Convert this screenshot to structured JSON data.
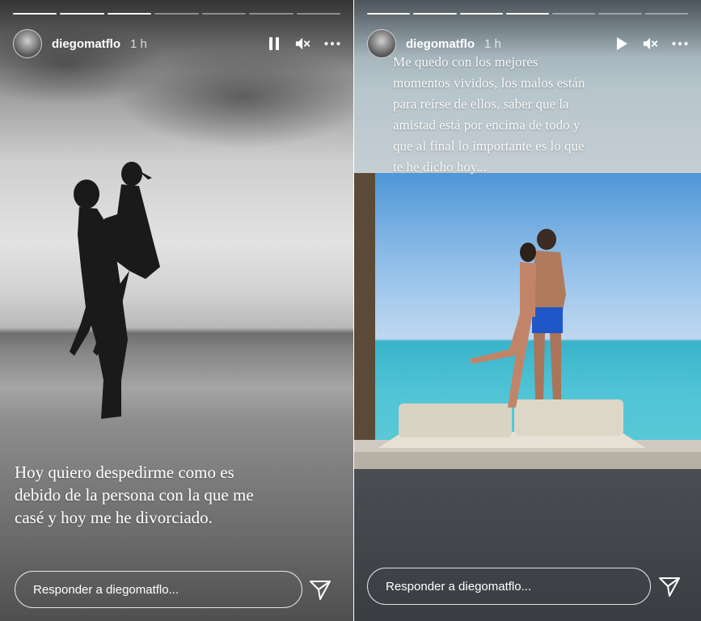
{
  "stories": [
    {
      "username": "diegomatflo",
      "time": "1 h",
      "playback_icon": "pause-icon",
      "caption_lines": [
        "Hoy quiero despedirme como es",
        "debido de la persona con la que me",
        "casé y hoy me he divorciado."
      ],
      "reply_placeholder": "Responder a diegomatflo...",
      "progress_total": 7,
      "progress_done": 3
    },
    {
      "username": "diegomatflo",
      "time": "1 h",
      "playback_icon": "play-icon",
      "caption_lines": [
        "Me quedo con los mejores",
        "momentos vividos, los malos están",
        "para reírse de ellos, saber que la",
        "amistad está por encima de todo y",
        "que al final lo importante es lo que",
        "te he dicho hoy..."
      ],
      "reply_placeholder": "Responder a diegomatflo...",
      "progress_total": 7,
      "progress_done": 4
    }
  ],
  "icons": {
    "mute": "speaker-muted-icon",
    "more": "more-options-icon",
    "send": "send-icon"
  }
}
